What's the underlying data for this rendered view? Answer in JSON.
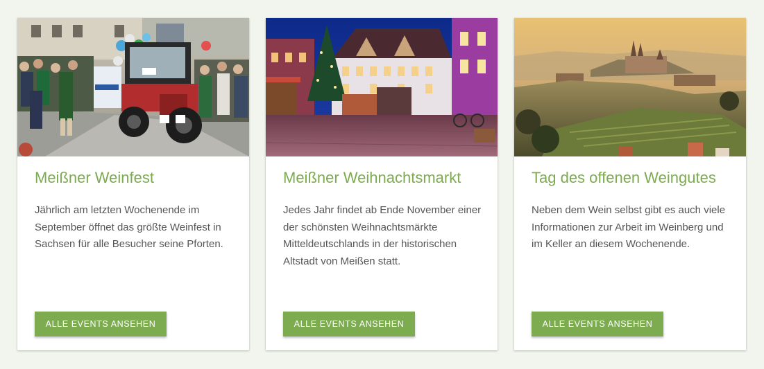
{
  "cards": [
    {
      "title": "Meißner Weinfest",
      "text": "Jährlich am letzten Wochenende im September öffnet das größte Weinfest in Sachsen für alle Besucher seine Pforten.",
      "button": "ALLE EVENTS ANSEHEN",
      "image_alt": "Tractor parade at the wine festival"
    },
    {
      "title": "Meißner Weihnachtsmarkt",
      "text": "Jedes Jahr findet ab Ende November einer der schönsten Weihnachtsmärkte Mitteldeutschlands in der historischen Altstadt von Meißen statt.",
      "button": "ALLE EVENTS ANSEHEN",
      "image_alt": "Christmas market on the old town square at night"
    },
    {
      "title": "Tag des offenen Weingutes",
      "text": "Neben dem Wein selbst gibt es auch viele Informationen zur Arbeit im Weinberg und im Keller an diesem Wochenende.",
      "button": "ALLE EVENTS ANSEHEN",
      "image_alt": "Vineyards overlooking Meißen cathedral at sunset"
    }
  ],
  "colors": {
    "accent": "#7dab50",
    "text": "#555555",
    "background": "#f2f5ee",
    "card": "#ffffff"
  }
}
